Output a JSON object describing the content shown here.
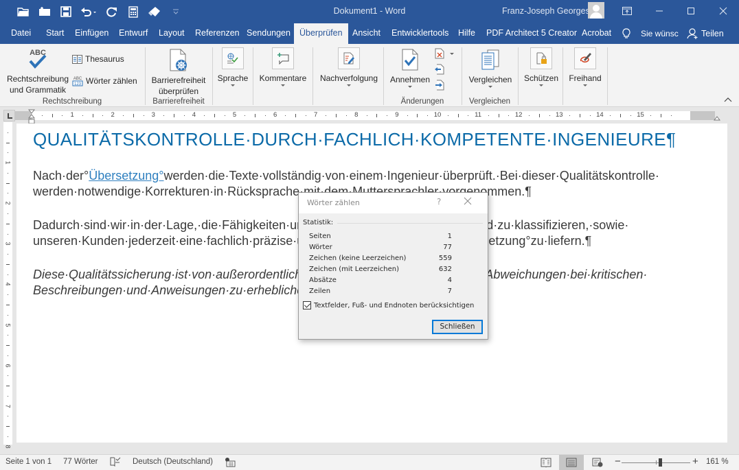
{
  "titlebar": {
    "doc_title": "Dokument1  -  Word",
    "user_name": "Franz-Joseph Georges",
    "qat_icons": [
      "open-folder-icon",
      "new-folder-icon",
      "save-icon",
      "undo-icon",
      "redo-icon",
      "calculator-icon",
      "eraser-icon",
      "customize-qat-icon"
    ]
  },
  "tabs": [
    {
      "label": "Datei"
    },
    {
      "label": "Start"
    },
    {
      "label": "Einfügen"
    },
    {
      "label": "Entwurf"
    },
    {
      "label": "Layout"
    },
    {
      "label": "Referenzen"
    },
    {
      "label": "Sendungen"
    },
    {
      "label": "Überprüfen",
      "active": true
    },
    {
      "label": "Ansicht"
    },
    {
      "label": "Entwicklertools"
    },
    {
      "label": "Hilfe"
    },
    {
      "label": "PDF Architect 5 Creator"
    },
    {
      "label": "Acrobat"
    }
  ],
  "tell_me": "Sie wünsc",
  "share": "Teilen",
  "ribbon": {
    "groups": {
      "rechtschreibung": {
        "label": "Rechtschreibung",
        "spelling_line1": "Rechtschreibung",
        "spelling_line2": "und Grammatik",
        "thesaurus": "Thesaurus",
        "word_count": "Wörter zählen"
      },
      "barrierefreiheit": {
        "label": "Barrierefreiheit",
        "check_line1": "Barrierefreiheit",
        "check_line2": "überprüfen"
      },
      "sprache": {
        "button": "Sprache"
      },
      "kommentare": {
        "button": "Kommentare"
      },
      "nachverfolgung": {
        "button": "Nachverfolgung"
      },
      "aenderungen": {
        "label": "Änderungen",
        "accept": "Annehmen"
      },
      "vergleichen": {
        "label": "Vergleichen",
        "button": "Vergleichen"
      },
      "schuetzen": {
        "button": "Schützen"
      },
      "freihand": {
        "button": "Freihand"
      }
    }
  },
  "ruler": {
    "horizontal_ticks": [
      "1",
      "2",
      "3",
      "4",
      "5",
      "6",
      "7",
      "8",
      "9",
      "10",
      "11",
      "12",
      "13",
      "14",
      "15"
    ],
    "vertical_ticks": [
      "1",
      "2",
      "3",
      "4",
      "5",
      "6",
      "7",
      "8"
    ]
  },
  "document": {
    "heading": "QUALITÄTSKONTROLLE·DURCH·FACHLICH·KOMPETENTE·INGENIEURE¶",
    "p1": {
      "pre": "Nach·der°",
      "link": "Übersetzung°",
      "post": "werden·die·Texte·vollständig·von·einem·Ingenieur·überprüft.·Bei·dieser·Qualitätskontrolle·",
      "line2": "werden·notwendige·Korrekturen·in·Rücksprache·mit·dem·Muttersprachler·vorgenommen.¶"
    },
    "p2": {
      "line1": "Dadurch·sind·wir·in·der·Lage,·die·Fähigkeiten·unserer·Übersetzer·zu·bewerten·und·zu·klassifizieren,·sowie·",
      "line2": "unseren·Kunden·jederzeit·eine·fachlich·präzise·und·sprachlich·einwandfreie·Übersetzung°zu·liefern.¶"
    },
    "p3": {
      "line1": "Diese·Qualitätssicherung·ist·von·außerordentlicher·Bedeutung,·da·schon·kleinste·Abweichungen·bei·kritischen·",
      "line2": "Beschreibungen·und·Anweisungen·zu·erheblichen·Problemen·führen·können.¶"
    }
  },
  "dialog": {
    "title": "Wörter zählen",
    "help": "?",
    "section": "Statistik:",
    "stats": [
      {
        "label": "Seiten",
        "value": "1"
      },
      {
        "label": "Wörter",
        "value": "77"
      },
      {
        "label": "Zeichen (keine Leerzeichen)",
        "value": "559"
      },
      {
        "label": "Zeichen (mit Leerzeichen)",
        "value": "632"
      },
      {
        "label": "Absätze",
        "value": "4"
      },
      {
        "label": "Zeilen",
        "value": "7"
      }
    ],
    "checkbox_label": "Textfelder, Fuß- und Endnoten berücksichtigen",
    "checkbox_checked": true,
    "close_button": "Schließen"
  },
  "statusbar": {
    "page": "Seite 1 von 1",
    "words": "77 Wörter",
    "language": "Deutsch (Deutschland)",
    "zoom": "161 %",
    "zoom_percent": 161
  },
  "colors": {
    "brand": "#2b579a",
    "heading": "#0b6aa8",
    "link": "#2e7fbf",
    "dialog_focus": "#0078d7"
  }
}
